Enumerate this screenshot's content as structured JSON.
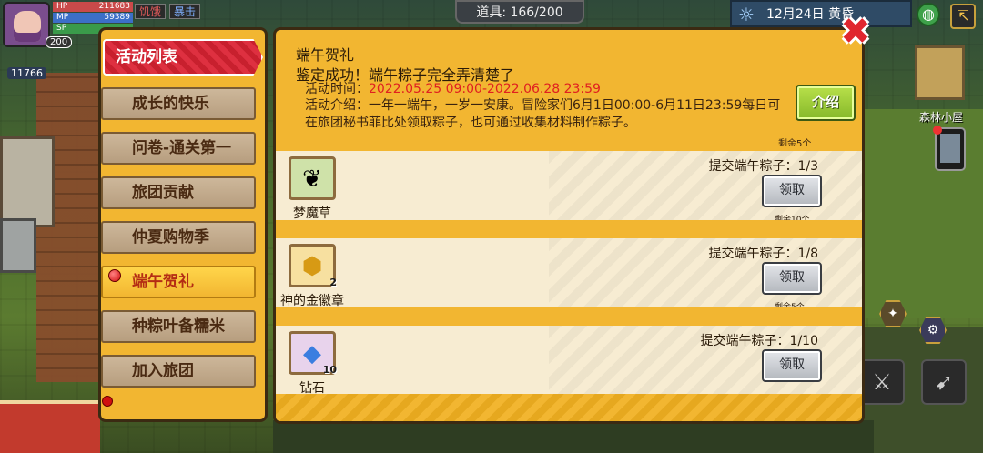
{
  "hud": {
    "level": "200",
    "hp_label": "HP",
    "hp_value": "211683",
    "mp_label": "MP",
    "mp_value": "59389",
    "sp_label": "SP",
    "status_hunger": "饥饿",
    "status_crit": "暴击",
    "side_counter": "11766",
    "props_label": "道具: 166/200",
    "date_label": "12月24日 黄昏",
    "forest_label": "森林小屋"
  },
  "side_menu": {
    "header": "活动列表",
    "items": [
      {
        "label": "成长的快乐",
        "selected": false
      },
      {
        "label": "问卷-通关第一",
        "selected": false
      },
      {
        "label": "旅团贡献",
        "selected": false
      },
      {
        "label": "仲夏购物季",
        "selected": false
      },
      {
        "label": "端午贺礼",
        "selected": true
      },
      {
        "label": "种粽叶备糯米",
        "selected": false
      },
      {
        "label": "加入旅团",
        "selected": false
      }
    ]
  },
  "panel": {
    "title": "端午贺礼",
    "toast": "鉴定成功！端午粽子完全弄清楚了",
    "time_label": "活动时间：",
    "time_value": "2022.05.25 09:00-2022.06.28 23:59",
    "intro": "活动介绍：一年一端午，一岁一安康。冒险家们6月1日00:00-6月11日23:59每日可在旅团秘书菲比处领取粽子，也可通过收集材料制作粽子。",
    "intro_button": "介绍",
    "cut_remaining": "剩余5个",
    "tasks": [
      {
        "item": "梦魔草",
        "icon": "plant-icon",
        "count": "",
        "progress": "提交端午粽子：1/3",
        "button": "领取",
        "remaining": "剩余10个"
      },
      {
        "item": "神的金徽章",
        "icon": "gold-badge-icon",
        "count": "2",
        "progress": "提交端午粽子：1/8",
        "button": "领取",
        "remaining": "剩余5个"
      },
      {
        "item": "钻石",
        "icon": "diamond-icon",
        "count": "10",
        "progress": "提交端午粽子：1/10",
        "button": "领取",
        "remaining": ""
      }
    ]
  },
  "colors": {
    "panel_bg": "#f2b631",
    "header_red": "#de3040",
    "time_red": "#e02020",
    "intro_btn_green": "#86b82a",
    "close_red": "#e0262e"
  }
}
